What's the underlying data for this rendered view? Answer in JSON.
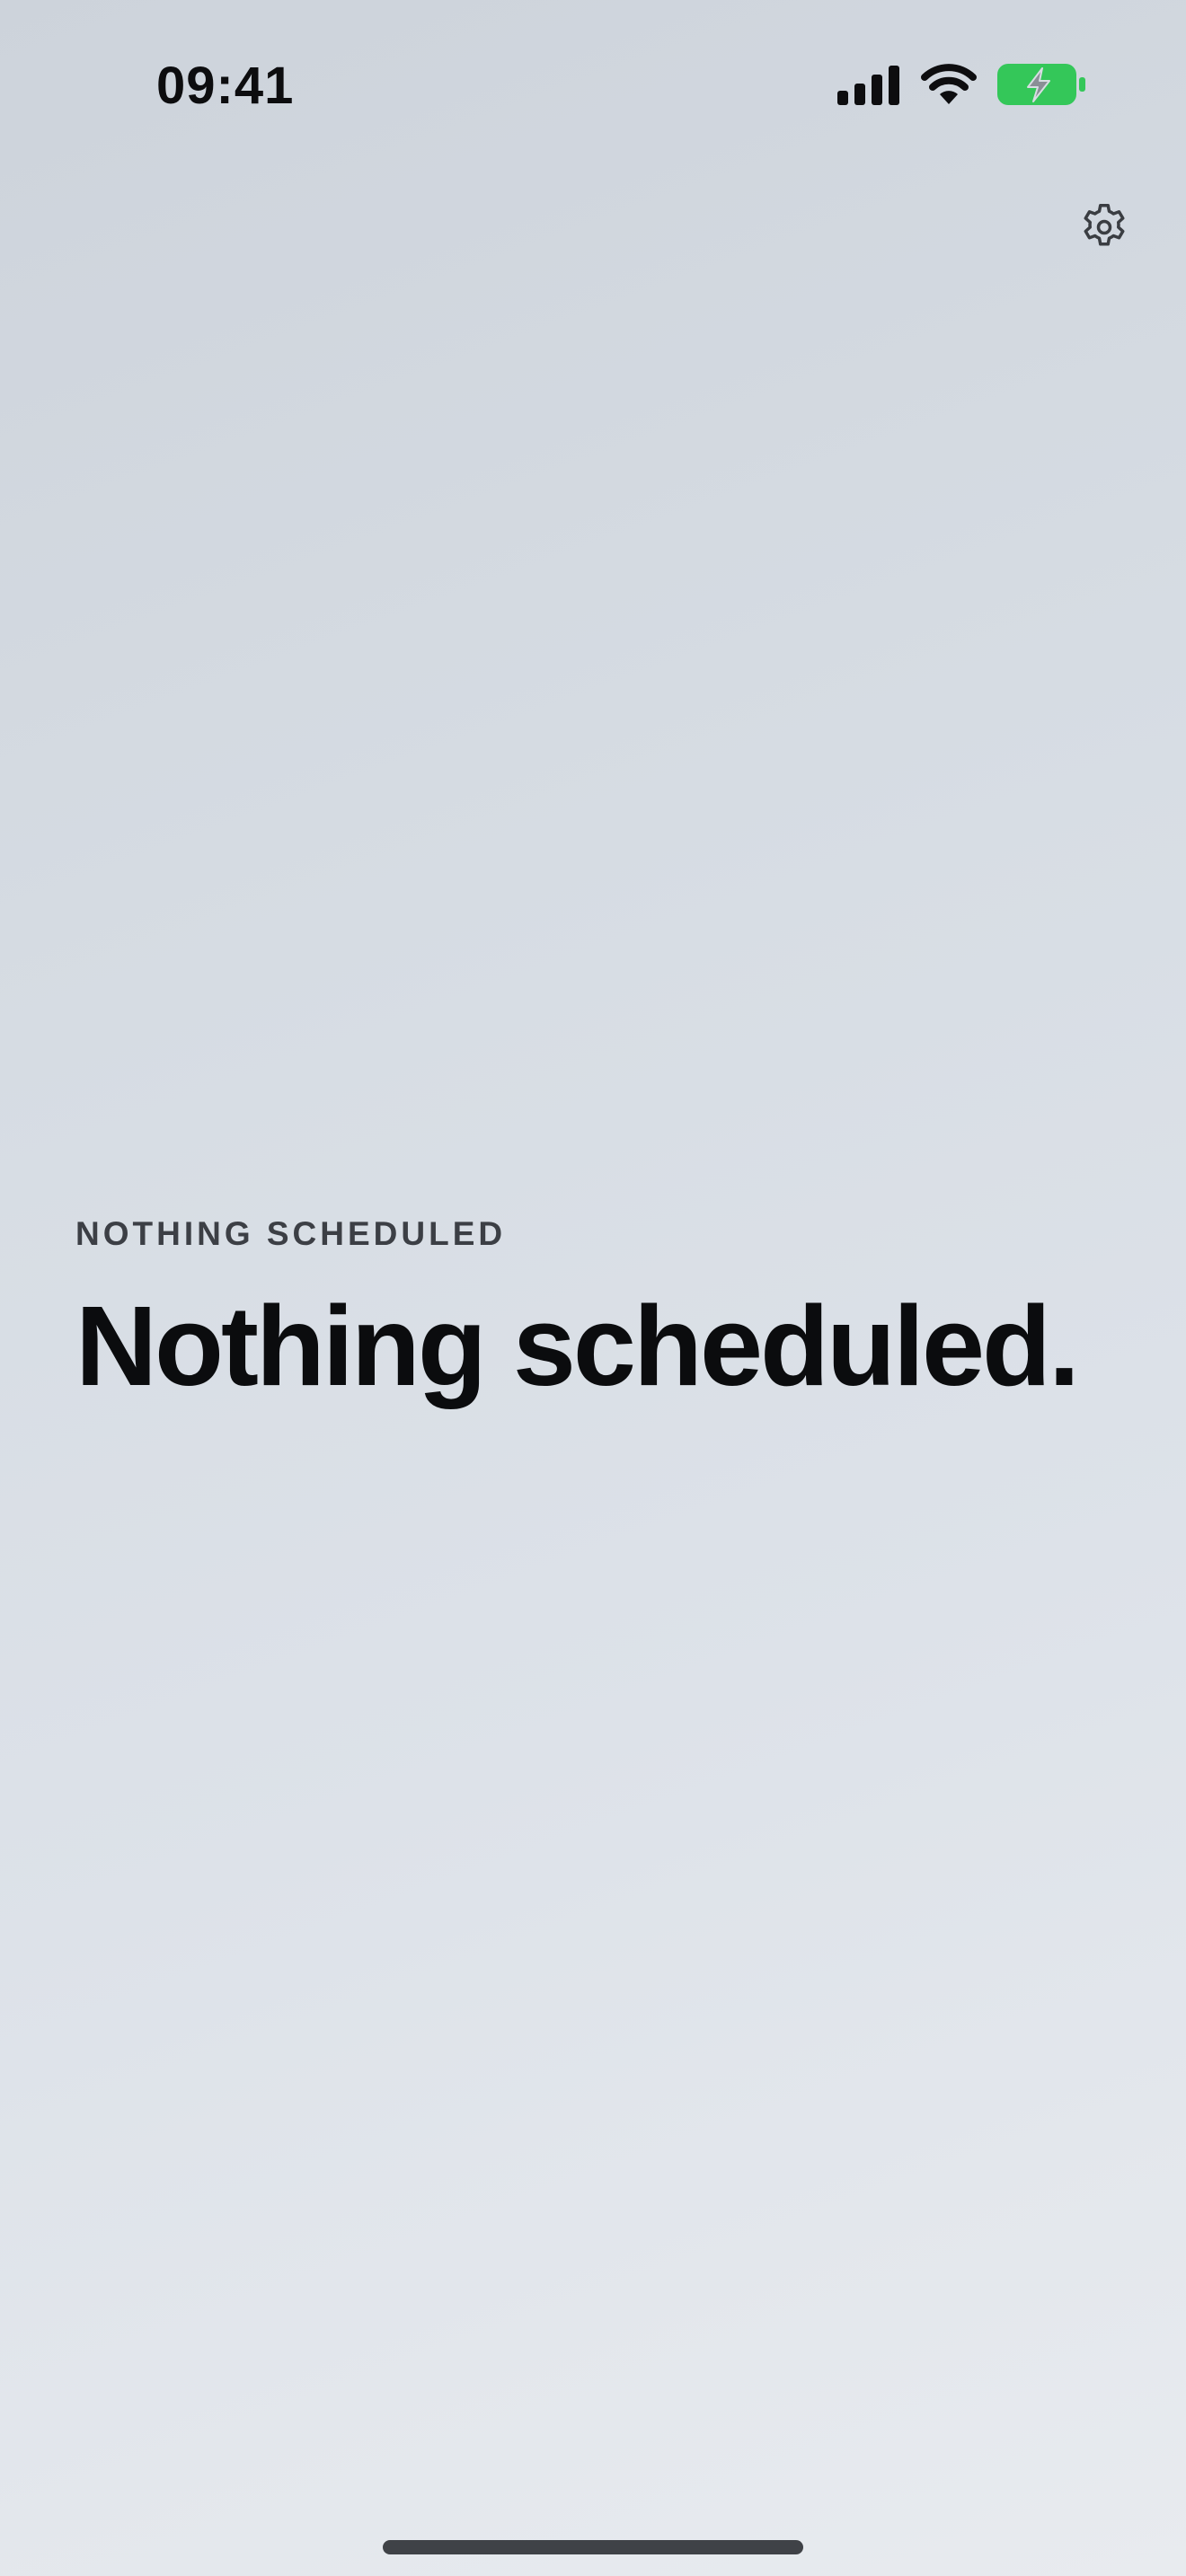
{
  "status_bar": {
    "time": "09:41",
    "icons": [
      "cellular-signal-icon",
      "wifi-icon",
      "battery-charging-icon"
    ],
    "battery_color": "#34c759"
  },
  "toolbar": {
    "settings_icon": "gear-icon"
  },
  "empty_state": {
    "eyebrow": "NOTHING SCHEDULED",
    "headline": "Nothing scheduled."
  }
}
